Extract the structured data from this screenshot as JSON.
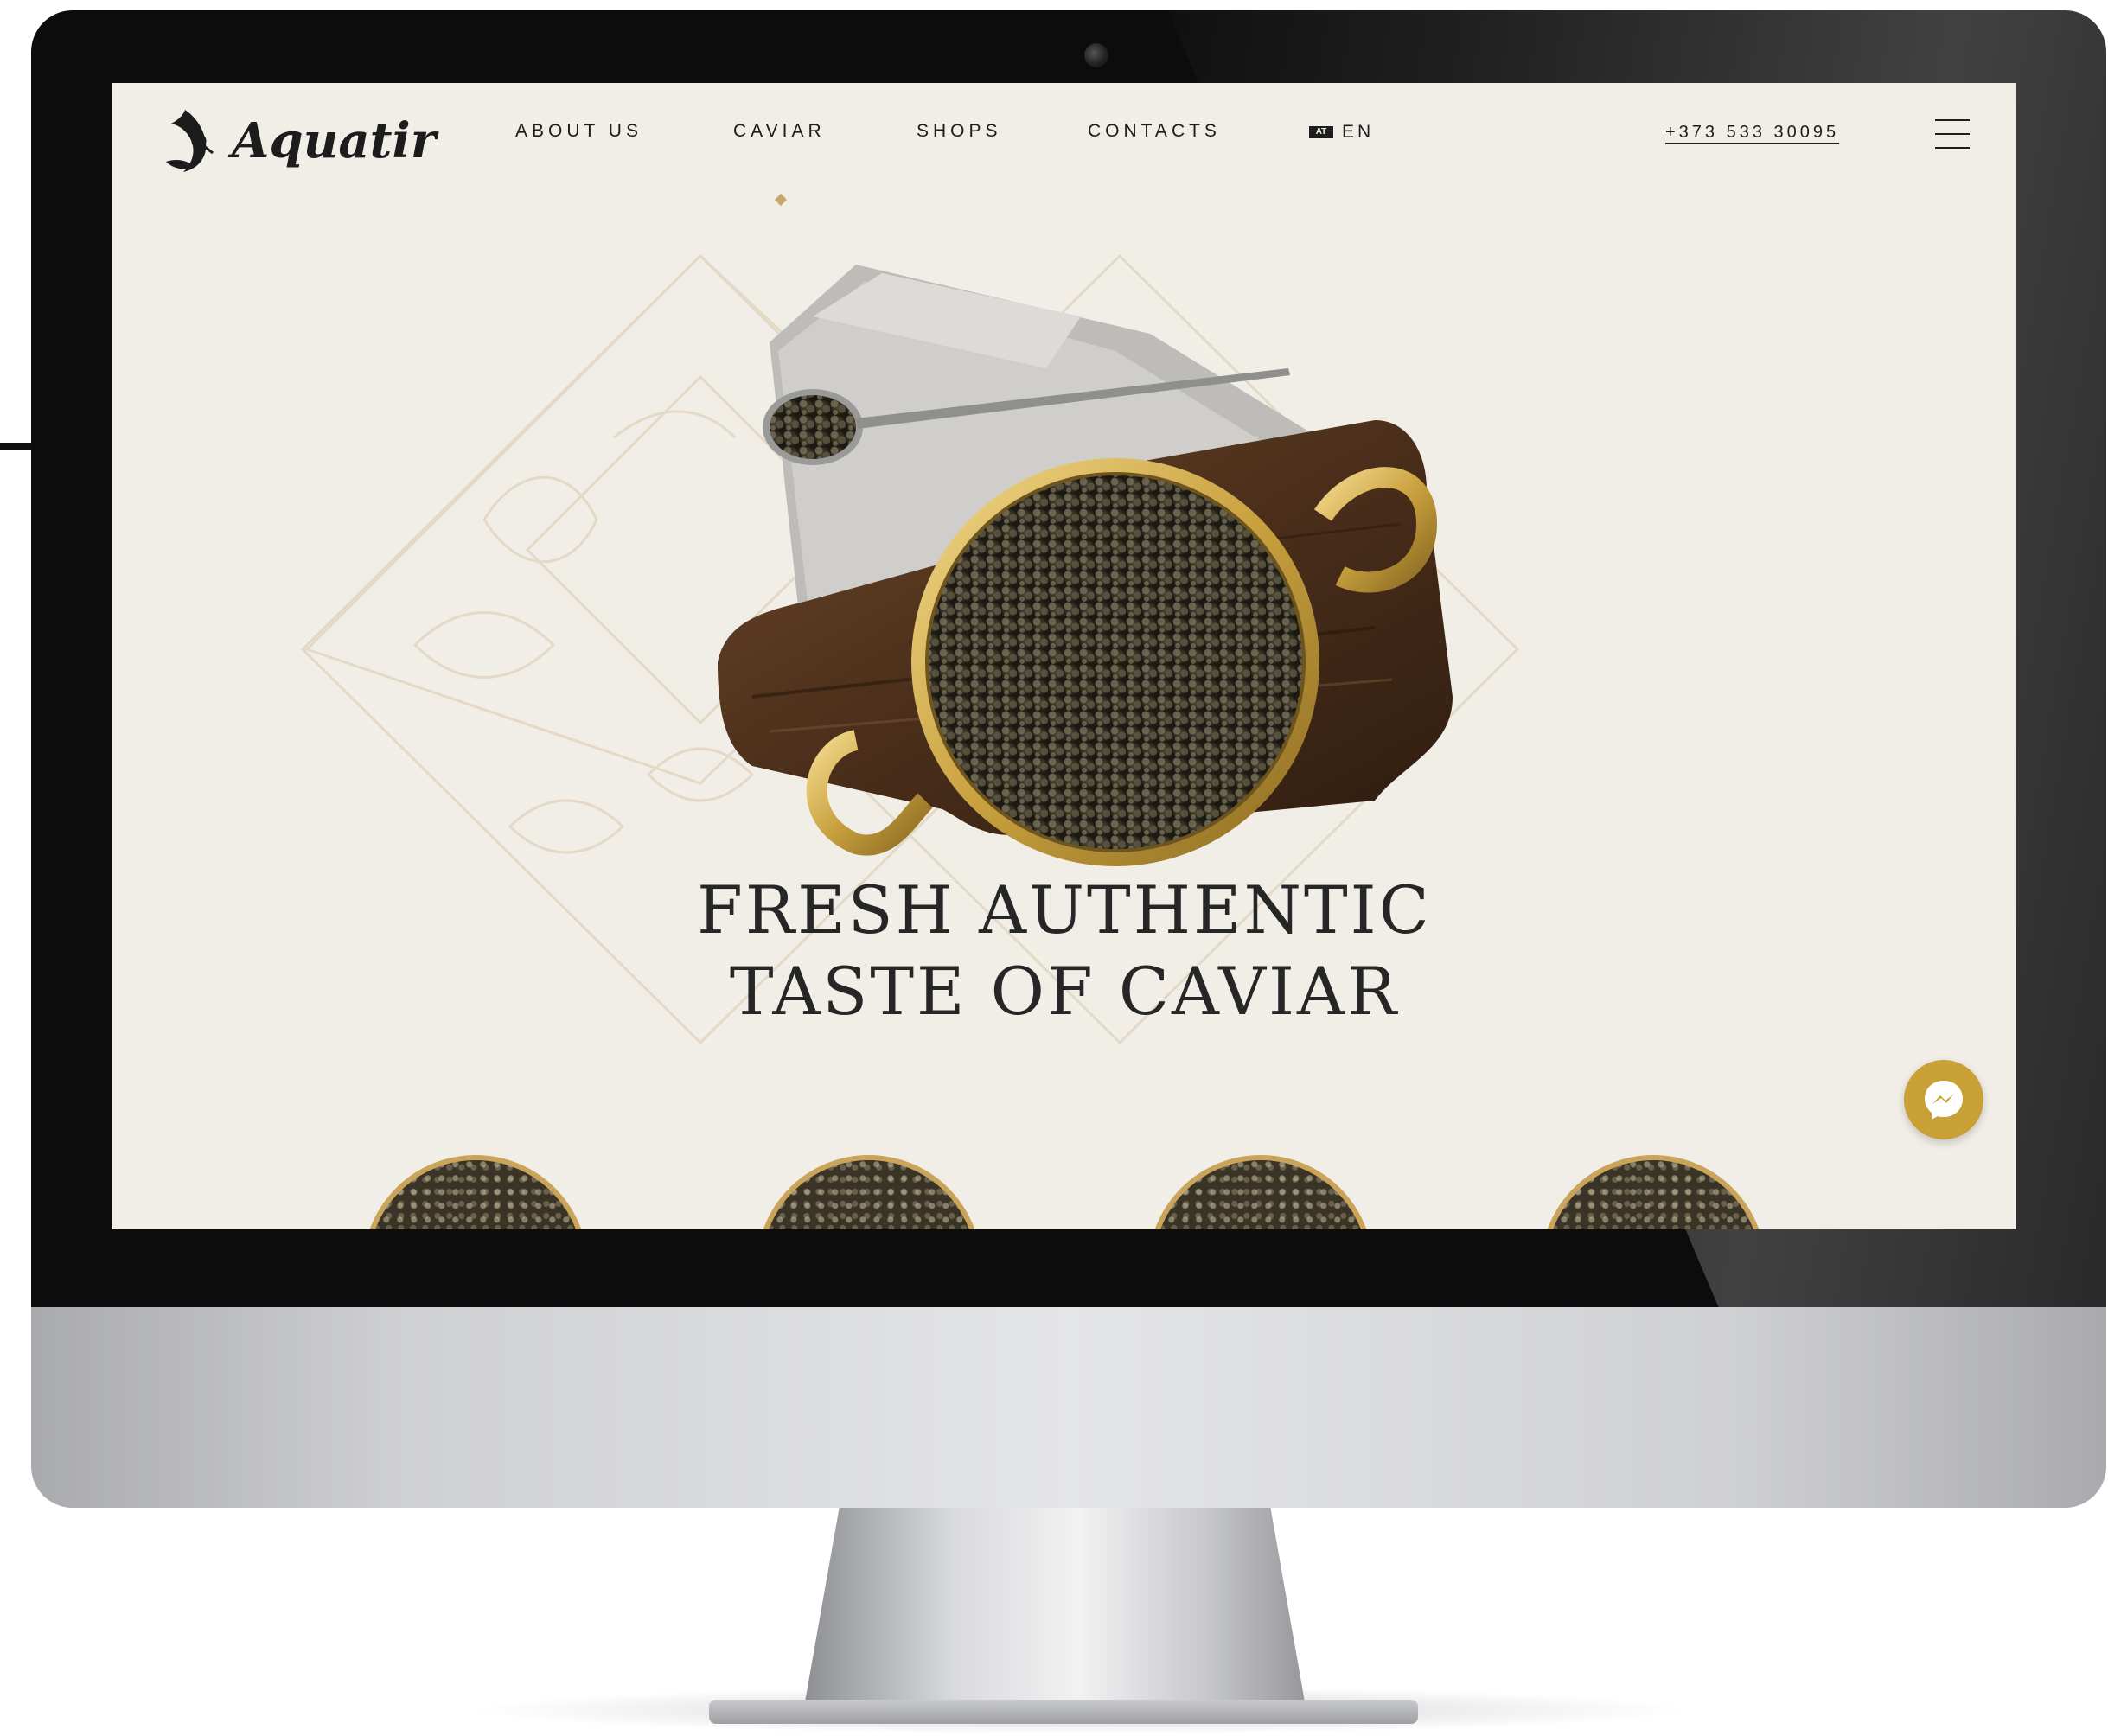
{
  "site": {
    "brand": "Aquatir",
    "nav": [
      {
        "label": "ABOUT US",
        "active": false
      },
      {
        "label": "CAVIAR",
        "active": true
      },
      {
        "label": "SHOPS",
        "active": false
      },
      {
        "label": "CONTACTS",
        "active": false
      }
    ],
    "language": {
      "flag": "AT",
      "label": "EN"
    },
    "phone": "+373 533 30095",
    "hero": {
      "headline_line1": "FRESH AUTHENTIC",
      "headline_line2": "TASTE OF CAVIAR",
      "image": "caviar-tin-on-wooden-board"
    },
    "products": [
      "caviar-bowl",
      "caviar-bowl",
      "caviar-bowl",
      "caviar-bowl"
    ],
    "chat_icon": "messenger-icon"
  },
  "colors": {
    "background": "#f1eee8",
    "accent_gold": "#c9a036",
    "text_dark": "#1d1d1d",
    "pattern_line": "#e3d7c4"
  }
}
